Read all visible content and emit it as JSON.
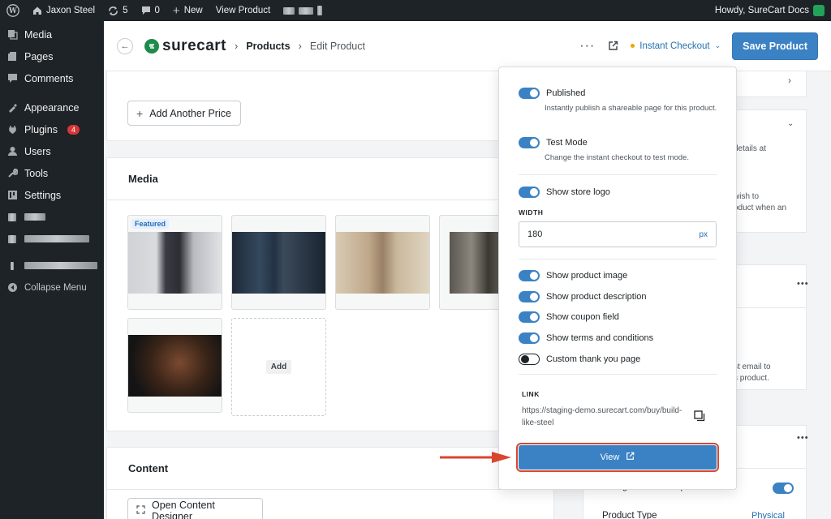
{
  "adminbar": {
    "site_name": "Jaxon Steel",
    "updates_count": "5",
    "comments_count": "0",
    "new_label": "New",
    "view_label": "View Product",
    "howdy": "Howdy, SureCart Docs"
  },
  "sidebar": {
    "items": [
      {
        "label": "Media",
        "icon": "media-icon"
      },
      {
        "label": "Pages",
        "icon": "pages-icon"
      },
      {
        "label": "Comments",
        "icon": "comments-icon"
      },
      {
        "label": "Appearance",
        "icon": "appearance-icon"
      },
      {
        "label": "Plugins",
        "icon": "plugins-icon",
        "badge": "4"
      },
      {
        "label": "Users",
        "icon": "users-icon"
      },
      {
        "label": "Tools",
        "icon": "tools-icon"
      },
      {
        "label": "Settings",
        "icon": "settings-icon"
      }
    ],
    "collapse_label": "Collapse Menu"
  },
  "header": {
    "brand": "surecart",
    "breadcrumb_root": "Products",
    "breadcrumb_current": "Edit Product",
    "instant_checkout": "Instant Checkout",
    "save_label": "Save Product"
  },
  "main": {
    "add_price_label": "Add Another Price",
    "media_title": "Media",
    "featured_label": "Featured",
    "add_media_label": "Add",
    "content_title": "Content",
    "open_designer_label": "Open Content Designer"
  },
  "right_panel": {
    "frag1_line1": "details at",
    "frag2_line1": "wish to",
    "frag2_line2": "oduct when an",
    "frag3_line1": "st email to",
    "frag3_line2": "s product.",
    "tax_label": "Charge tax on this product",
    "product_type_label": "Product Type",
    "product_type_value": "Physical"
  },
  "popover": {
    "published_label": "Published",
    "published_desc": "Instantly publish a shareable page for this product.",
    "test_mode_label": "Test Mode",
    "test_mode_desc": "Change the instant checkout to test mode.",
    "store_logo_label": "Show store logo",
    "width_label": "WIDTH",
    "width_value": "180",
    "width_unit": "px",
    "product_image_label": "Show product image",
    "product_desc_label": "Show product description",
    "coupon_label": "Show coupon field",
    "terms_label": "Show terms and conditions",
    "thankyou_label": "Custom thank you page",
    "link_label": "LINK",
    "link_url": "https://staging-demo.surecart.com/buy/build-like-steel",
    "view_label": "View"
  },
  "colors": {
    "accent": "#3b82c4",
    "highlight": "#d9462f",
    "sidebar_bg": "#1d2327"
  }
}
